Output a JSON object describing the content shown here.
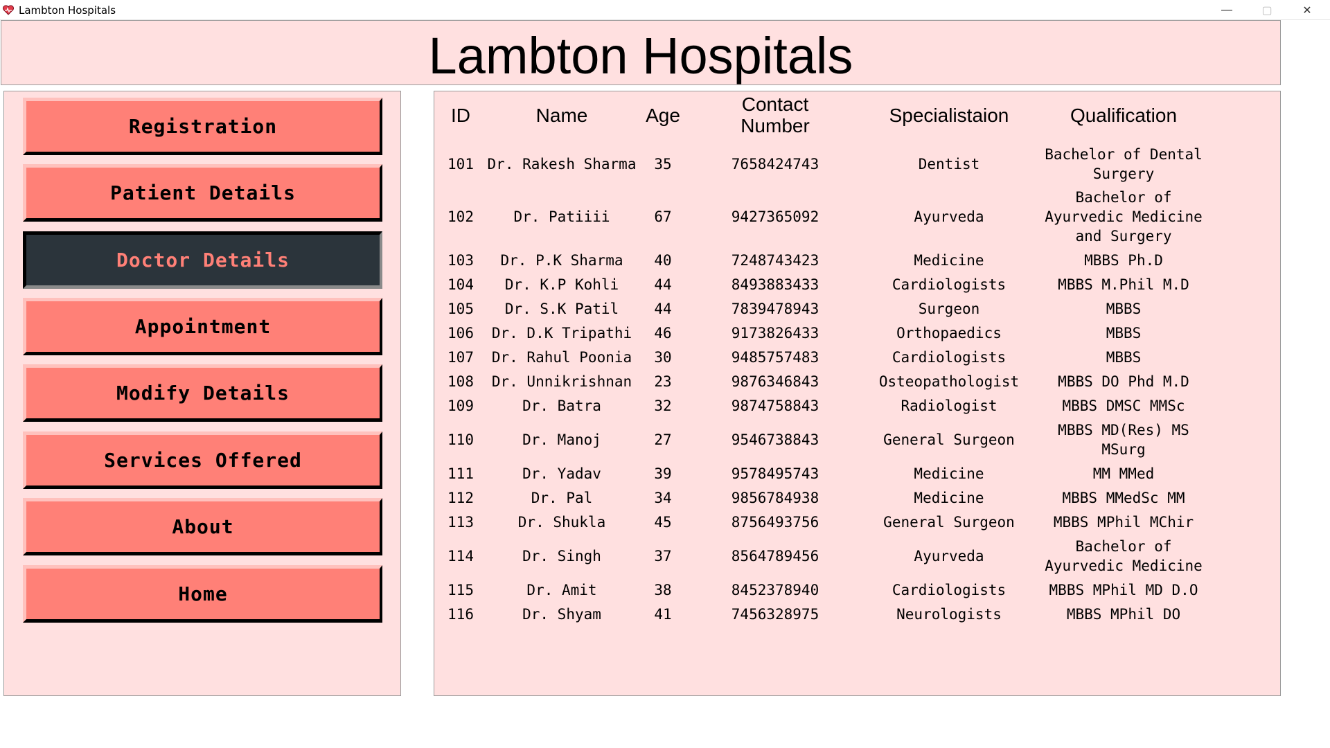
{
  "window": {
    "title": "Lambton Hospitals",
    "controls": {
      "minimize": "—",
      "maximize": "▢",
      "close": "✕"
    }
  },
  "header": {
    "title": "Lambton Hospitals"
  },
  "sidebar": {
    "items": [
      {
        "label": "Registration",
        "active": false
      },
      {
        "label": "Patient Details",
        "active": false
      },
      {
        "label": "Doctor Details",
        "active": true
      },
      {
        "label": "Appointment",
        "active": false
      },
      {
        "label": "Modify Details",
        "active": false
      },
      {
        "label": "Services Offered",
        "active": false
      },
      {
        "label": "About",
        "active": false
      },
      {
        "label": "Home",
        "active": false
      }
    ]
  },
  "table": {
    "headers": {
      "id": "ID",
      "name": "Name",
      "age": "Age",
      "contact": "Contact Number",
      "specialization": "Specialistaion",
      "qualification": "Qualification"
    },
    "rows": [
      {
        "id": "101",
        "name": "Dr. Rakesh Sharma",
        "age": "35",
        "contact": "7658424743",
        "specialization": "Dentist",
        "qualification": "Bachelor of Dental Surgery"
      },
      {
        "id": "102",
        "name": "Dr. Patiiii",
        "age": "67",
        "contact": "9427365092",
        "specialization": "Ayurveda",
        "qualification": "Bachelor of Ayurvedic Medicine and Surgery"
      },
      {
        "id": "103",
        "name": "Dr. P.K Sharma",
        "age": "40",
        "contact": "7248743423",
        "specialization": "Medicine",
        "qualification": "MBBS Ph.D"
      },
      {
        "id": "104",
        "name": "Dr. K.P Kohli",
        "age": "44",
        "contact": "8493883433",
        "specialization": "Cardiologists",
        "qualification": "MBBS M.Phil M.D"
      },
      {
        "id": "105",
        "name": "Dr. S.K Patil",
        "age": "44",
        "contact": "7839478943",
        "specialization": "Surgeon",
        "qualification": "MBBS"
      },
      {
        "id": "106",
        "name": "Dr. D.K Tripathi",
        "age": "46",
        "contact": "9173826433",
        "specialization": "Orthopaedics",
        "qualification": "MBBS"
      },
      {
        "id": "107",
        "name": "Dr. Rahul Poonia",
        "age": "30",
        "contact": "9485757483",
        "specialization": "Cardiologists",
        "qualification": "MBBS"
      },
      {
        "id": "108",
        "name": "Dr. Unnikrishnan",
        "age": "23",
        "contact": "9876346843",
        "specialization": "Osteopathologist",
        "qualification": "MBBS DO Phd M.D"
      },
      {
        "id": "109",
        "name": "Dr. Batra",
        "age": "32",
        "contact": "9874758843",
        "specialization": "Radiologist",
        "qualification": "MBBS DMSC MMSc"
      },
      {
        "id": "110",
        "name": "Dr. Manoj",
        "age": "27",
        "contact": "9546738843",
        "specialization": "General Surgeon",
        "qualification": "MBBS MD(Res) MS MSurg"
      },
      {
        "id": "111",
        "name": "Dr. Yadav",
        "age": "39",
        "contact": "9578495743",
        "specialization": "Medicine",
        "qualification": "MM MMed"
      },
      {
        "id": "112",
        "name": "Dr. Pal",
        "age": "34",
        "contact": "9856784938",
        "specialization": "Medicine",
        "qualification": "MBBS MMedSc MM"
      },
      {
        "id": "113",
        "name": "Dr. Shukla",
        "age": "45",
        "contact": "8756493756",
        "specialization": "General Surgeon",
        "qualification": "MBBS MPhil MChir"
      },
      {
        "id": "114",
        "name": "Dr. Singh",
        "age": "37",
        "contact": "8564789456",
        "specialization": "Ayurveda",
        "qualification": "Bachelor of Ayurvedic Medicine"
      },
      {
        "id": "115",
        "name": "Dr. Amit",
        "age": "38",
        "contact": "8452378940",
        "specialization": "Cardiologists",
        "qualification": "MBBS MPhil MD D.O"
      },
      {
        "id": "116",
        "name": "Dr. Shyam",
        "age": "41",
        "contact": "7456328975",
        "specialization": "Neurologists",
        "qualification": "MBBS MPhil DO"
      }
    ]
  }
}
